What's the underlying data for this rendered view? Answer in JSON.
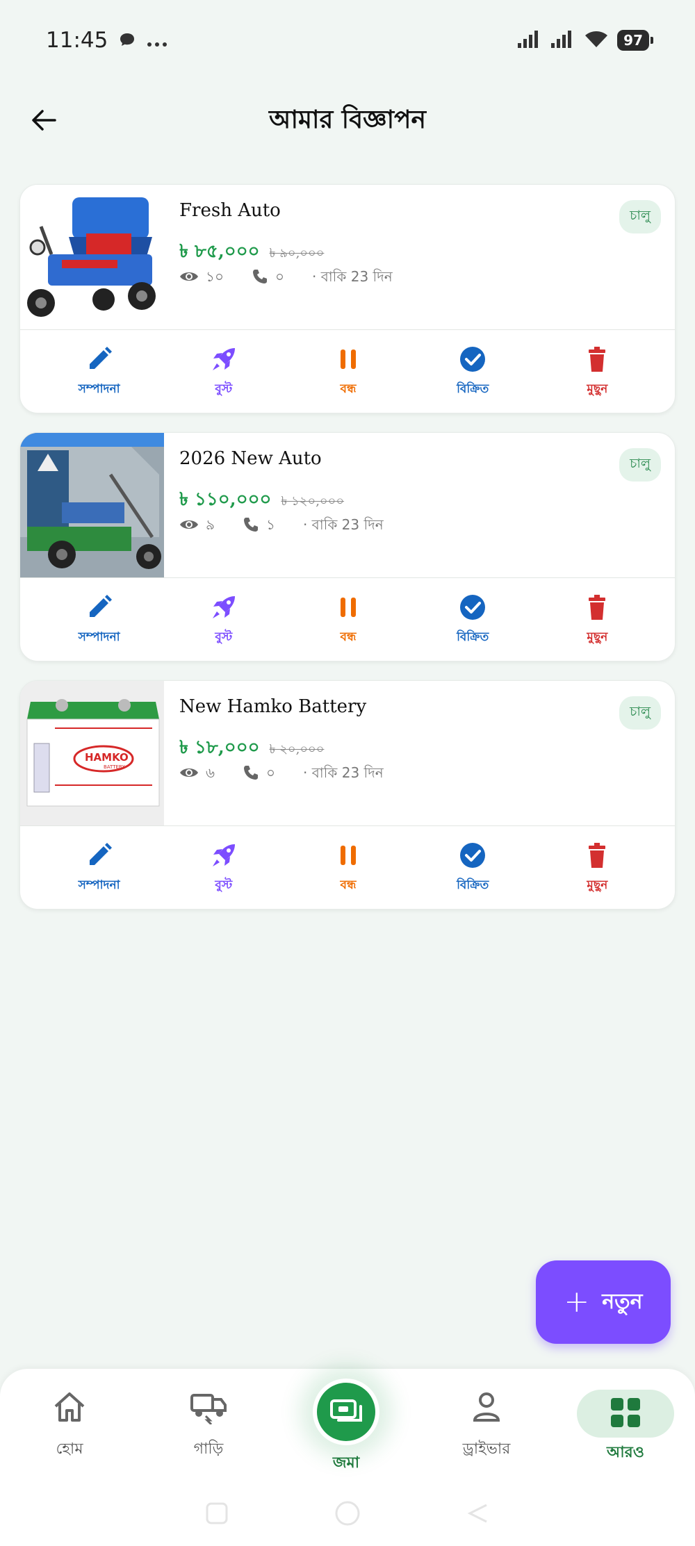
{
  "status_bar": {
    "time": "11:45",
    "battery": "97"
  },
  "header": {
    "title": "আমার বিজ্ঞাপন"
  },
  "listings": [
    {
      "title": "Fresh Auto",
      "status": "চালু",
      "price": "৳ ৮৫,০০০",
      "old_price": "৳ ৯০,০০০",
      "views": "১০",
      "calls": "০",
      "remaining": "· বাকি 23 দিন"
    },
    {
      "title": "2026 New Auto",
      "status": "চালু",
      "price": "৳ ১১০,০০০",
      "old_price": "৳ ১২০,০০০",
      "views": "৯",
      "calls": "১",
      "remaining": "· বাকি 23 দিন"
    },
    {
      "title": "New Hamko Battery",
      "status": "চালু",
      "price": "৳ ১৮,০০০",
      "old_price": "৳ ২০,০০০",
      "views": "৬",
      "calls": "০",
      "remaining": "· বাকি 23 দিন",
      "image_brand": "HAMKO",
      "image_sub": "BATTERY"
    }
  ],
  "actions": {
    "edit": "সম্পাদনা",
    "boost": "বুস্ট",
    "pause": "বন্ধ",
    "sold": "বিক্রিত",
    "delete": "মুছুন"
  },
  "colors": {
    "edit": "#1565c0",
    "boost": "#7c4dff",
    "pause": "#ef6c00",
    "sold": "#1565c0",
    "delete": "#d32f2f",
    "accent": "#1f9a4b"
  },
  "fab": {
    "label": "নতুন"
  },
  "bottom_nav": {
    "home": "হোম",
    "vehicles": "গাড়ি",
    "deposit": "জমা",
    "driver": "ড্রাইভার",
    "more": "আরও"
  }
}
